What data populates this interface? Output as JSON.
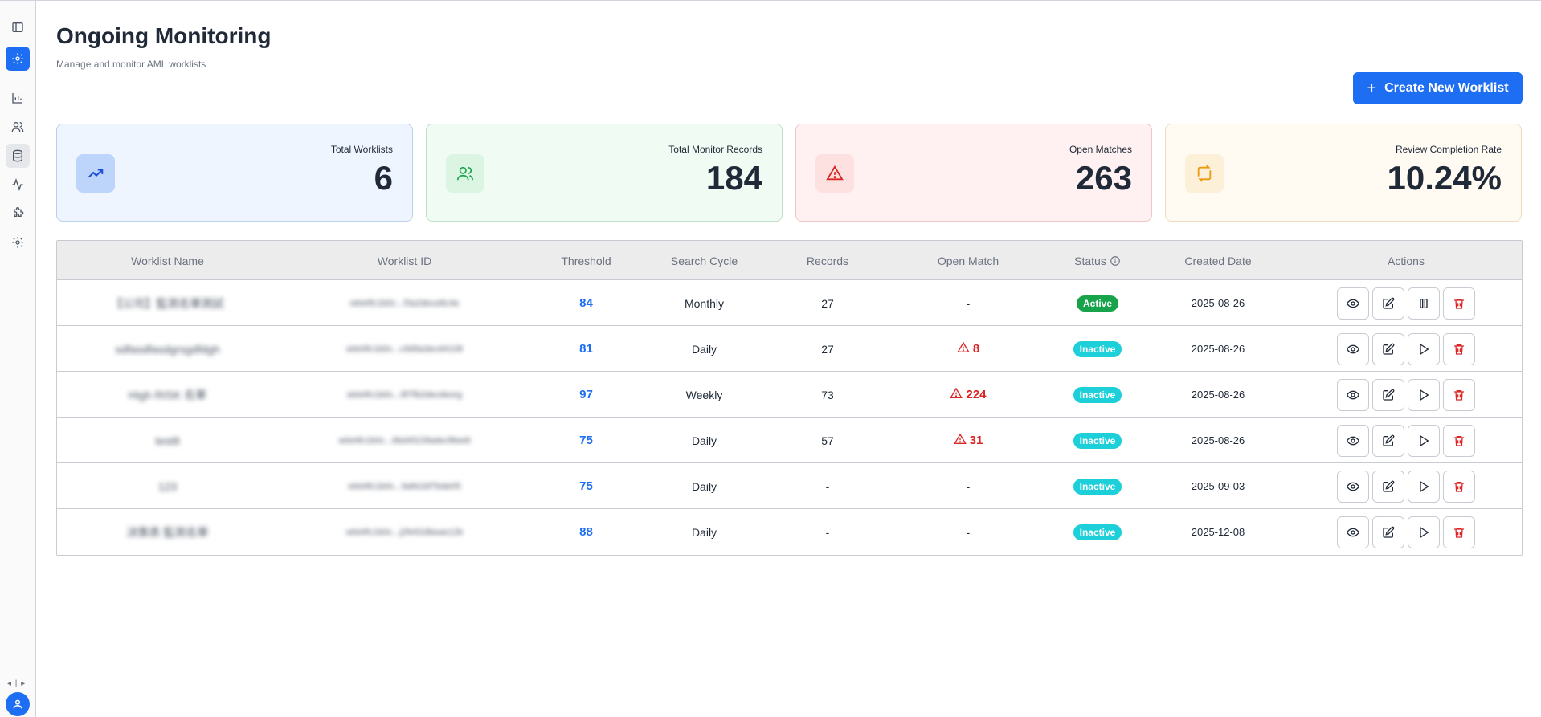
{
  "page": {
    "title": "Ongoing Monitoring",
    "subtitle": "Manage and monitor AML worklists",
    "create_button": "Create New Worklist"
  },
  "sidebar": {
    "items": [
      "panel-toggle-icon",
      "settings-icon",
      "bar-chart-icon",
      "users-icon",
      "database-icon",
      "activity-icon",
      "puzzle-icon",
      "gear-icon"
    ],
    "active": "settings-icon",
    "collapse_label": "◂ | ▸"
  },
  "stats": [
    {
      "label": "Total Worklists",
      "value": "6",
      "icon": "trending-up-icon"
    },
    {
      "label": "Total Monitor Records",
      "value": "184",
      "icon": "users-icon"
    },
    {
      "label": "Open Matches",
      "value": "263",
      "icon": "alert-triangle-icon"
    },
    {
      "label": "Review Completion Rate",
      "value": "10.24%",
      "icon": "refresh-icon"
    }
  ],
  "table": {
    "headers": {
      "name": "Worklist Name",
      "id": "Worklist ID",
      "threshold": "Threshold",
      "cycle": "Search Cycle",
      "records": "Records",
      "open_match": "Open Match",
      "status": "Status",
      "created": "Created Date",
      "actions": "Actions"
    },
    "rows": [
      {
        "name": "【公司】監測名單測試",
        "id": "wlst4fc1b0c...f3a2dece8c4e",
        "threshold": "84",
        "cycle": "Monthly",
        "records": "27",
        "open_match": "-",
        "status": "Active",
        "created": "2025-08-26",
        "run_action": "pause"
      },
      {
        "name": "sdfasdfasdgrsgdfdgh",
        "id": "wlst4fc1b0c...c9d9a3ecd4108",
        "threshold": "81",
        "cycle": "Daily",
        "records": "27",
        "open_match": "8",
        "status": "Inactive",
        "created": "2025-08-26",
        "run_action": "play"
      },
      {
        "name": "High RISK 名單",
        "id": "wlst4fc1b0c...8f7fb2decdeorg",
        "threshold": "97",
        "cycle": "Weekly",
        "records": "73",
        "open_match": "224",
        "status": "Inactive",
        "created": "2025-08-26",
        "run_action": "play"
      },
      {
        "name": "test8",
        "id": "wlst4fc1b0c...6bd4523fadecf8ee8",
        "threshold": "75",
        "cycle": "Daily",
        "records": "57",
        "open_match": "31",
        "status": "Inactive",
        "created": "2025-08-26",
        "run_action": "play"
      },
      {
        "name": "123",
        "id": "wlst4fc1b0c...fa6b1bf7bde05",
        "threshold": "75",
        "cycle": "Daily",
        "records": "-",
        "open_match": "-",
        "status": "Inactive",
        "created": "2025-09-03",
        "run_action": "play"
      },
      {
        "name": "決策表 監測名單",
        "id": "wlst4fc1b0c...j2fe92dbeae12b",
        "threshold": "88",
        "cycle": "Daily",
        "records": "-",
        "open_match": "-",
        "status": "Inactive",
        "created": "2025-12-08",
        "run_action": "play"
      }
    ]
  },
  "colors": {
    "accent": "#1d6ef2",
    "active_badge": "#16a34a",
    "inactive_badge": "#1ccfd9",
    "warning": "#dc2626"
  }
}
